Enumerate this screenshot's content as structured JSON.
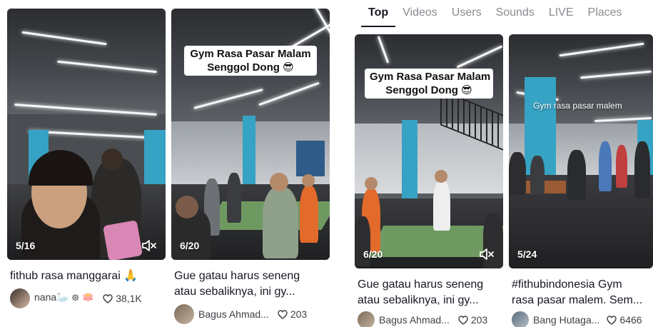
{
  "tabs": [
    {
      "label": "Top",
      "active": true
    },
    {
      "label": "Videos",
      "active": false
    },
    {
      "label": "Users",
      "active": false
    },
    {
      "label": "Sounds",
      "active": false
    },
    {
      "label": "LIVE",
      "active": false
    },
    {
      "label": "Places",
      "active": false
    }
  ],
  "cards": [
    {
      "count": "5/16",
      "title": "fithub rasa manggarai 🙏",
      "author": "nana🦢 ᪥ 🪷",
      "likes": "38,1K"
    },
    {
      "count": "6/20",
      "bubble_line1": "Gym Rasa Pasar Malam",
      "bubble_line2": "Senggol Dong 😎",
      "title_line1": "Gue gatau harus seneng",
      "title_line2": "atau sebaliknya, ini gy...",
      "author": "Bagus Ahmad...",
      "likes": "203"
    },
    {
      "count": "6/20",
      "bubble_line1": "Gym Rasa Pasar Malam",
      "bubble_line2": "Senggol Dong 😎",
      "title_line1": "Gue gatau harus seneng",
      "title_line2": "atau sebaliknya, ini gy...",
      "author": "Bagus Ahmad...",
      "likes": "203"
    },
    {
      "count": "5/24",
      "overlay": "Gym rasa pasar malem",
      "title_line1": "#fithubindonesia Gym",
      "title_line2": "rasa pasar malem. Sem...",
      "author": "Bang Hutaga...",
      "likes": "6466"
    }
  ],
  "colors": {
    "text": "#161823",
    "muted": "#8a8b91",
    "pillar": "#36a3c4",
    "turf": "#6e9a62"
  }
}
